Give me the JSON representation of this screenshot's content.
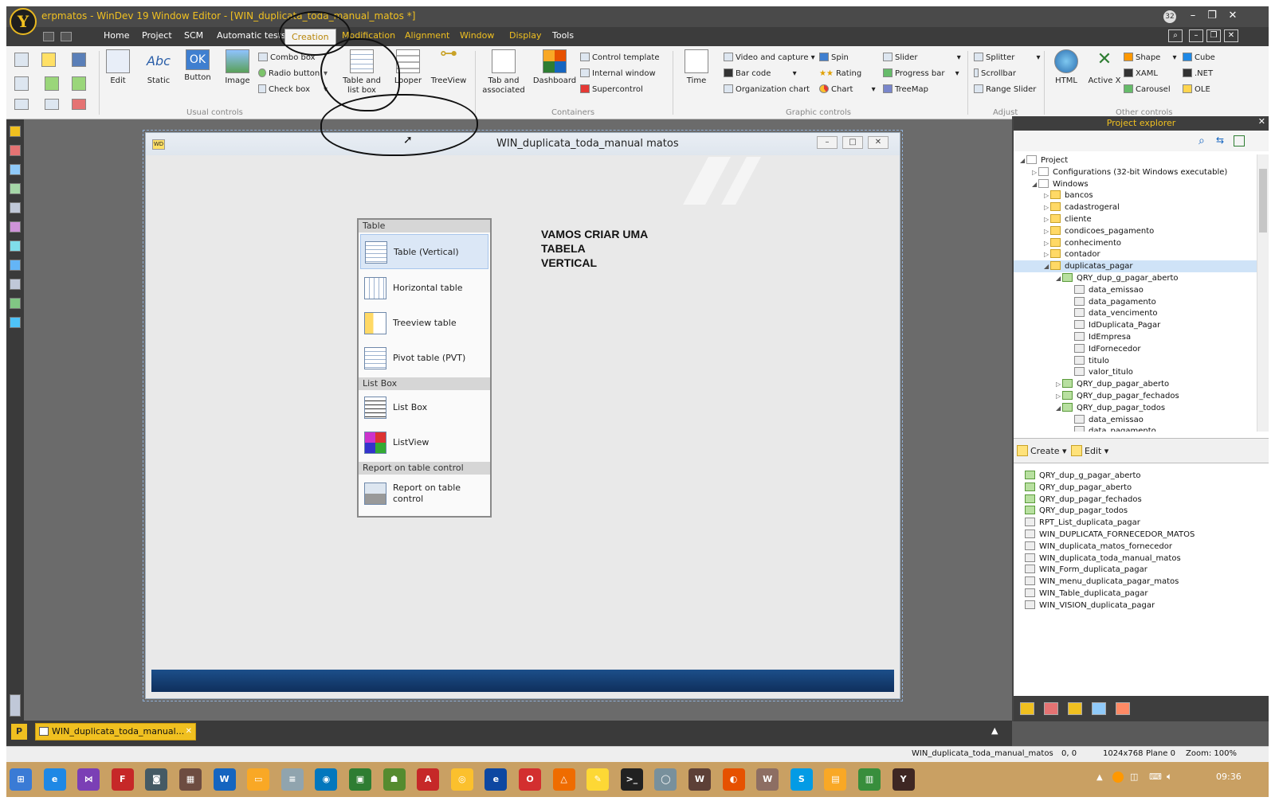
{
  "window": {
    "title": "erpmatos - WinDev 19  Window Editor - [WIN_duplicata_toda_manual_matos *]",
    "notification_count": "32"
  },
  "menu": [
    "Home",
    "Project",
    "SCM",
    "Automatic tests",
    "Creation",
    "Modification",
    "Alignment",
    "Window",
    "Display",
    "Tools"
  ],
  "menu_active": "Creation",
  "ribbon": {
    "usual": {
      "label": "Usual controls",
      "edit": "Edit",
      "static": "Static",
      "static_glyph": "Abc",
      "button": "Button",
      "button_glyph": "OK",
      "image": "Image",
      "combo": "Combo box",
      "radio": "Radio button",
      "check": "Check box"
    },
    "table": {
      "label": "Table and list box",
      "looper": "Looper",
      "treeview": "TreeView"
    },
    "containers": {
      "label": "Containers",
      "tab": "Tab and associated",
      "dashboard": "Dashboard",
      "control_template": "Control template",
      "internal_window": "Internal window",
      "supercontrol": "Supercontrol"
    },
    "graphic": {
      "label": "Graphic controls",
      "time": "Time",
      "video": "Video and capture",
      "barcode": "Bar code",
      "orgchart": "Organization chart",
      "spin": "Spin",
      "rating": "Rating",
      "chart": "Chart",
      "slider": "Slider",
      "progress": "Progress bar",
      "treemap": "TreeMap"
    },
    "adjust": {
      "label": "Adjust",
      "splitter": "Splitter",
      "scrollbar": "Scrollbar",
      "range_slider": "Range Slider"
    },
    "other": {
      "label": "Other controls",
      "html": "HTML",
      "activex": "Active X",
      "shape": "Shape",
      "xaml": "XAML",
      "carousel": "Carousel",
      "cube": "Cube",
      "net": ".NET",
      "ole": "OLE"
    }
  },
  "designer": {
    "window_title": "WIN_duplicata_toda_manual matos",
    "label_text": "VAMOS CRIAR UMA\nTABELA\nVERTICAL"
  },
  "dropdown": {
    "sections": [
      {
        "header": "Table",
        "items": [
          "Table (Vertical)",
          "Horizontal table",
          "Treeview table",
          "Pivot table (PVT)"
        ]
      },
      {
        "header": "List Box",
        "items": [
          "List Box",
          "ListView"
        ]
      },
      {
        "header": "Report on table control",
        "items": [
          "Report on table control"
        ]
      }
    ],
    "highlighted": "Table (Vertical)"
  },
  "project_explorer": {
    "title": "Project explorer",
    "tree": [
      {
        "level": 0,
        "label": "Project",
        "exp": "◢",
        "icon": "project"
      },
      {
        "level": 1,
        "label": "Configurations (32-bit Windows executable)",
        "exp": "▷",
        "icon": "config"
      },
      {
        "level": 1,
        "label": "Windows",
        "exp": "◢",
        "icon": "windows"
      },
      {
        "level": 2,
        "label": "bancos",
        "exp": "▷",
        "icon": "folder"
      },
      {
        "level": 2,
        "label": "cadastrogeral",
        "exp": "▷",
        "icon": "folder"
      },
      {
        "level": 2,
        "label": "cliente",
        "exp": "▷",
        "icon": "folder"
      },
      {
        "level": 2,
        "label": "condicoes_pagamento",
        "exp": "▷",
        "icon": "folder"
      },
      {
        "level": 2,
        "label": "conhecimento",
        "exp": "▷",
        "icon": "folder"
      },
      {
        "level": 2,
        "label": "contador",
        "exp": "▷",
        "icon": "folder"
      },
      {
        "level": 2,
        "label": "duplicatas_pagar",
        "exp": "◢",
        "icon": "folder",
        "selected": true
      },
      {
        "level": 3,
        "label": "QRY_dup_g_pagar_aberto",
        "exp": "◢",
        "icon": "qry"
      },
      {
        "level": 4,
        "label": "data_emissao",
        "exp": "",
        "icon": "fld"
      },
      {
        "level": 4,
        "label": "data_pagamento",
        "exp": "",
        "icon": "fld"
      },
      {
        "level": 4,
        "label": "data_vencimento",
        "exp": "",
        "icon": "fld"
      },
      {
        "level": 4,
        "label": "IdDuplicata_Pagar",
        "exp": "",
        "icon": "fld"
      },
      {
        "level": 4,
        "label": "IdEmpresa",
        "exp": "",
        "icon": "fld"
      },
      {
        "level": 4,
        "label": "IdFornecedor",
        "exp": "",
        "icon": "fld"
      },
      {
        "level": 4,
        "label": "titulo",
        "exp": "",
        "icon": "fld"
      },
      {
        "level": 4,
        "label": "valor_titulo",
        "exp": "",
        "icon": "fld"
      },
      {
        "level": 3,
        "label": "QRY_dup_pagar_aberto",
        "exp": "▷",
        "icon": "qry"
      },
      {
        "level": 3,
        "label": "QRY_dup_pagar_fechados",
        "exp": "▷",
        "icon": "qry"
      },
      {
        "level": 3,
        "label": "QRY_dup_pagar_todos",
        "exp": "◢",
        "icon": "qry"
      },
      {
        "level": 4,
        "label": "data_emissao",
        "exp": "",
        "icon": "fld"
      },
      {
        "level": 4,
        "label": "data_pagamento",
        "exp": "",
        "icon": "fld"
      }
    ],
    "create_label": "Create",
    "edit_label": "Edit",
    "elements": [
      {
        "label": "QRY_dup_g_pagar_aberto",
        "icon": "qry"
      },
      {
        "label": "QRY_dup_pagar_aberto",
        "icon": "qry"
      },
      {
        "label": "QRY_dup_pagar_fechados",
        "icon": "qry"
      },
      {
        "label": "QRY_dup_pagar_todos",
        "icon": "qry"
      },
      {
        "label": "RPT_List_duplicata_pagar",
        "icon": "rpt"
      },
      {
        "label": "WIN_DUPLICATA_FORNECEDOR_MATOS",
        "icon": "win"
      },
      {
        "label": "WIN_duplicata_matos_fornecedor",
        "icon": "win"
      },
      {
        "label": "WIN_duplicata_toda_manual_matos",
        "icon": "win"
      },
      {
        "label": "WIN_Form_duplicata_pagar",
        "icon": "win"
      },
      {
        "label": "WIN_menu_duplicata_pagar_matos",
        "icon": "win"
      },
      {
        "label": "WIN_Table_duplicata_pagar",
        "icon": "win"
      },
      {
        "label": "WIN_VISION_duplicata_pagar",
        "icon": "win"
      }
    ]
  },
  "doc_tab": "WIN_duplicata_toda_manual...",
  "status": {
    "window": "WIN_duplicata_toda_manual_matos",
    "coords": "0, 0",
    "resolution": "1024x768",
    "plane": "Plane 0",
    "zoom": "Zoom: 100%"
  },
  "taskbar": {
    "icons": [
      {
        "name": "windows-start-icon",
        "glyph": "⊞",
        "color": "#3a7bd5"
      },
      {
        "name": "ie-icon",
        "glyph": "e",
        "color": "#1e88e5"
      },
      {
        "name": "visual-studio-icon",
        "glyph": "⋈",
        "color": "#7b3fb5"
      },
      {
        "name": "filezilla-icon",
        "glyph": "F",
        "color": "#c62828"
      },
      {
        "name": "network-icon",
        "glyph": "◙",
        "color": "#455a64"
      },
      {
        "name": "calculator-icon",
        "glyph": "▦",
        "color": "#6d4c41"
      },
      {
        "name": "windev-project-icon",
        "glyph": "W",
        "color": "#1565c0"
      },
      {
        "name": "folder-icon",
        "glyph": "▭",
        "color": "#f9a825"
      },
      {
        "name": "notepad-icon",
        "glyph": "≡",
        "color": "#90a4ae"
      },
      {
        "name": "webdev-icon",
        "glyph": "◉",
        "color": "#0277bd"
      },
      {
        "name": "screenshot-icon",
        "glyph": "▣",
        "color": "#2e7d32"
      },
      {
        "name": "android-icon",
        "glyph": "☗",
        "color": "#558b2f"
      },
      {
        "name": "acrobat-icon",
        "glyph": "A",
        "color": "#c62828"
      },
      {
        "name": "chrome-icon",
        "glyph": "◎",
        "color": "#fbc02d"
      },
      {
        "name": "edge-icon",
        "glyph": "e",
        "color": "#0d47a1"
      },
      {
        "name": "opera-icon",
        "glyph": "O",
        "color": "#d32f2f"
      },
      {
        "name": "drive-icon",
        "glyph": "△",
        "color": "#ef6c00"
      },
      {
        "name": "notes-icon",
        "glyph": "✎",
        "color": "#fdd835"
      },
      {
        "name": "cmd-icon",
        "glyph": ">_",
        "color": "#212121"
      },
      {
        "name": "disc-icon",
        "glyph": "◯",
        "color": "#78909c"
      },
      {
        "name": "windev-icon",
        "glyph": "W",
        "color": "#5d4037"
      },
      {
        "name": "firefox-icon",
        "glyph": "◐",
        "color": "#e65100"
      },
      {
        "name": "webdev2-icon",
        "glyph": "W",
        "color": "#8d6e63"
      },
      {
        "name": "skype-icon",
        "glyph": "S",
        "color": "#039be5"
      },
      {
        "name": "explorer-icon",
        "glyph": "▤",
        "color": "#f9a825"
      },
      {
        "name": "chart-app-icon",
        "glyph": "▥",
        "color": "#388e3c"
      },
      {
        "name": "windev19-icon",
        "glyph": "Y",
        "color": "#3e2723"
      }
    ],
    "time": "09:36"
  }
}
